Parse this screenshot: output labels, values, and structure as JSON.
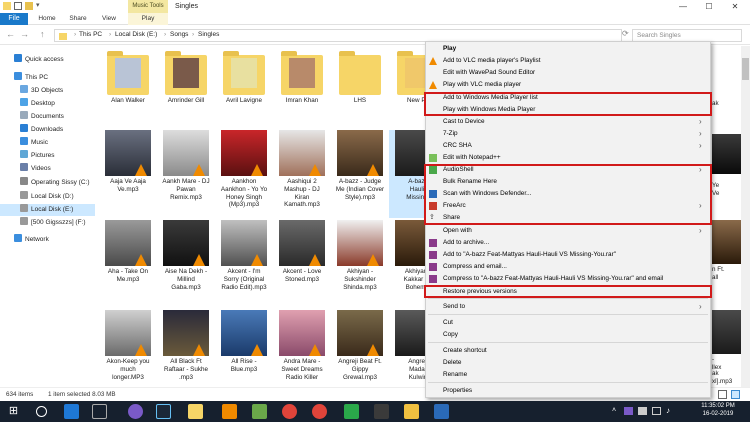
{
  "titlebar": {
    "contextual_tab": "Music Tools",
    "folder": "Singles"
  },
  "ribbon": {
    "file": "File",
    "home": "Home",
    "share": "Share",
    "view": "View",
    "play": "Play"
  },
  "address": {
    "crumbs": [
      "This PC",
      "Local Disk (E:)",
      "Songs",
      "Singles"
    ],
    "search_placeholder": "Search Singles"
  },
  "nav": [
    {
      "label": "Quick access"
    },
    {
      "label": "This PC"
    },
    {
      "label": "3D Objects"
    },
    {
      "label": "Desktop"
    },
    {
      "label": "Documents"
    },
    {
      "label": "Downloads"
    },
    {
      "label": "Music"
    },
    {
      "label": "Pictures"
    },
    {
      "label": "Videos"
    },
    {
      "label": "Operating Sissy (C:)"
    },
    {
      "label": "Local Disk (D:)"
    },
    {
      "label": "Local Disk (E:)"
    },
    {
      "label": "[500 Gigsszzs] (F:)"
    },
    {
      "label": "Network"
    }
  ],
  "files": [
    {
      "label": "Alan Walker"
    },
    {
      "label": "Amrinder Gill"
    },
    {
      "label": "Avril Lavigne"
    },
    {
      "label": "Imran Khan"
    },
    {
      "label": "LHS"
    },
    {
      "label": "New Pu"
    },
    {
      "label": "Aaja Ve Aaja\nVe.mp3"
    },
    {
      "label": "Aankh Mare - DJ\nPawan\nRemix.mp3"
    },
    {
      "label": "Aankhon\nAankhon - Yo Yo\nHoney Singh\n(Mp3).mp3"
    },
    {
      "label": "Aashiqui 2\nMashup - DJ\nKiran\nKamath.mp3"
    },
    {
      "label": "A-bazz - Judge\nMe (Indian Cover\nStyle).mp3"
    },
    {
      "label": "A-bazz\nHauli-\nMissing-"
    },
    {
      "label": "Aha - Take On\nMe.mp3"
    },
    {
      "label": "Aise Na Dekh -\nMillind\nGaba.mp3"
    },
    {
      "label": "Akcent - I'm\nSorry (Original\nRadio Edit).mp3"
    },
    {
      "label": "Akcent - Love\nStoned.mp3"
    },
    {
      "label": "Akhiyan -\nSukshinder\nShinda.mp3"
    },
    {
      "label": "Akhiyan -\nKakkar Fe\nBohemia"
    },
    {
      "label": "Akon-Keep you\nmuch\nlonger.MP3"
    },
    {
      "label": "All Black Ft\nRaftaar - Sukhe\n.mp3"
    },
    {
      "label": "All Rise -\nBlue.mp3"
    },
    {
      "label": "Andra Mare -\nSweet Dreams\nRadio Killer"
    },
    {
      "label": "Angreji Beat Ft.\nGippy\nGrewal.mp3"
    },
    {
      "label": "Angreji\nMadar\nKulwin"
    }
  ],
  "right_col": [
    {
      "label": "ak"
    },
    {
      "label": "Ye"
    },
    {
      "label": "Ve"
    },
    {
      "label": "n Ft.\nall"
    },
    {
      "label": "-\nllex"
    },
    {
      "label": "ak\nxl].mp3"
    }
  ],
  "status": {
    "count": "634 items",
    "selected": "1 item selected  8.03 MB"
  },
  "menu": [
    {
      "label": "Play"
    },
    {
      "label": "Add to VLC media player's Playlist"
    },
    {
      "label": "Edit with WavePad Sound Editor"
    },
    {
      "label": "Play with VLC media player"
    },
    {
      "label": "Add to Windows Media Player list"
    },
    {
      "label": "Play with Windows Media Player"
    },
    {
      "label": "Cast to Device"
    },
    {
      "label": "7-Zip"
    },
    {
      "label": "CRC SHA"
    },
    {
      "label": "Edit with Notepad++"
    },
    {
      "label": "AudioShell"
    },
    {
      "label": "Bulk Rename Here"
    },
    {
      "label": "Scan with Windows Defender..."
    },
    {
      "label": "FreeArc"
    },
    {
      "label": "Share"
    },
    {
      "label": "Open with"
    },
    {
      "label": "Add to archive..."
    },
    {
      "label": "Add to \"A-bazz Feat-Mattyas Hauli-Hauli VS Missing-You.rar\""
    },
    {
      "label": "Compress and email..."
    },
    {
      "label": "Compress to \"A-bazz Feat-Mattyas Hauli-Hauli VS Missing-You.rar\" and email"
    },
    {
      "label": "Restore previous versions"
    },
    {
      "label": "Send to"
    },
    {
      "label": "Cut"
    },
    {
      "label": "Copy"
    },
    {
      "label": "Create shortcut"
    },
    {
      "label": "Delete"
    },
    {
      "label": "Rename"
    },
    {
      "label": "Properties"
    }
  ],
  "clock": {
    "time": "11:35:02 PM",
    "date": "16-02-2019"
  }
}
